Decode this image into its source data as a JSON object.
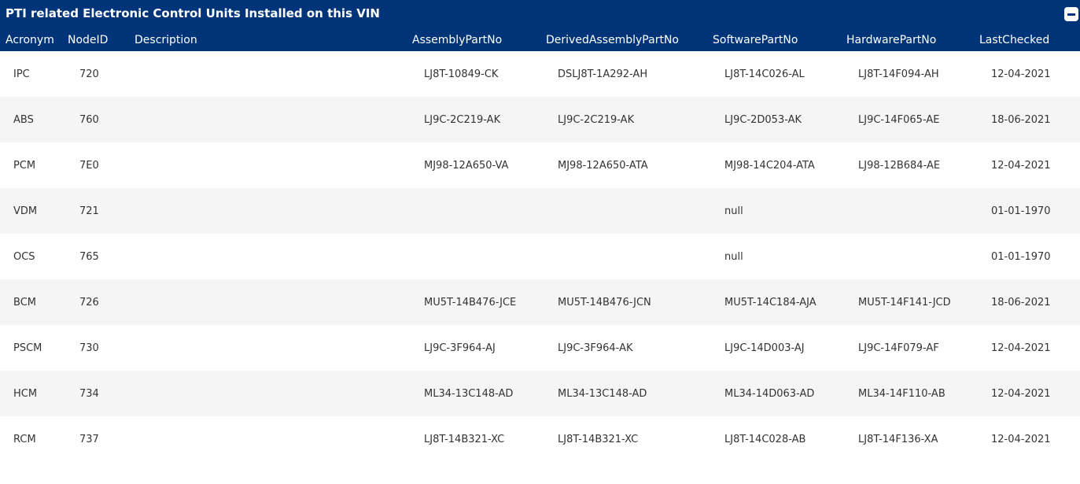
{
  "panel": {
    "title": "PTI related Electronic Control Units Installed on this VIN"
  },
  "columns": [
    "Acronym",
    "NodeID",
    "Description",
    "AssemblyPartNo",
    "DerivedAssemblyPartNo",
    "SoftwarePartNo",
    "HardwarePartNo",
    "LastChecked"
  ],
  "rows": [
    [
      "IPC",
      "720",
      "",
      "LJ8T-10849-CK",
      "DSLJ8T-1A292-AH",
      "LJ8T-14C026-AL",
      "LJ8T-14F094-AH",
      "12-04-2021"
    ],
    [
      "ABS",
      "760",
      "",
      "LJ9C-2C219-AK",
      "LJ9C-2C219-AK",
      "LJ9C-2D053-AK",
      "LJ9C-14F065-AE",
      "18-06-2021"
    ],
    [
      "PCM",
      "7E0",
      "",
      "MJ98-12A650-VA",
      "MJ98-12A650-ATA",
      "MJ98-14C204-ATA",
      "LJ98-12B684-AE",
      "12-04-2021"
    ],
    [
      "VDM",
      "721",
      "",
      "",
      "",
      "null",
      "",
      "01-01-1970"
    ],
    [
      "OCS",
      "765",
      "",
      "",
      "",
      "null",
      "",
      "01-01-1970"
    ],
    [
      "BCM",
      "726",
      "",
      "MU5T-14B476-JCE",
      "MU5T-14B476-JCN",
      "MU5T-14C184-AJA",
      "MU5T-14F141-JCD",
      "18-06-2021"
    ],
    [
      "PSCM",
      "730",
      "",
      "LJ9C-3F964-AJ",
      "LJ9C-3F964-AK",
      "LJ9C-14D003-AJ",
      "LJ9C-14F079-AF",
      "12-04-2021"
    ],
    [
      "HCM",
      "734",
      "",
      "ML34-13C148-AD",
      "ML34-13C148-AD",
      "ML34-14D063-AD",
      "ML34-14F110-AB",
      "12-04-2021"
    ],
    [
      "RCM",
      "737",
      "",
      "LJ8T-14B321-XC",
      "LJ8T-14B321-XC",
      "LJ8T-14C028-AB",
      "LJ8T-14F136-XA",
      "12-04-2021"
    ]
  ],
  "icons": {
    "collapse": "minus-square-icon"
  },
  "colors": {
    "header_bg": "#003478",
    "header_text": "#ffffff",
    "row_alt_bg": "#f5f5f5",
    "cell_text": "#333333"
  }
}
